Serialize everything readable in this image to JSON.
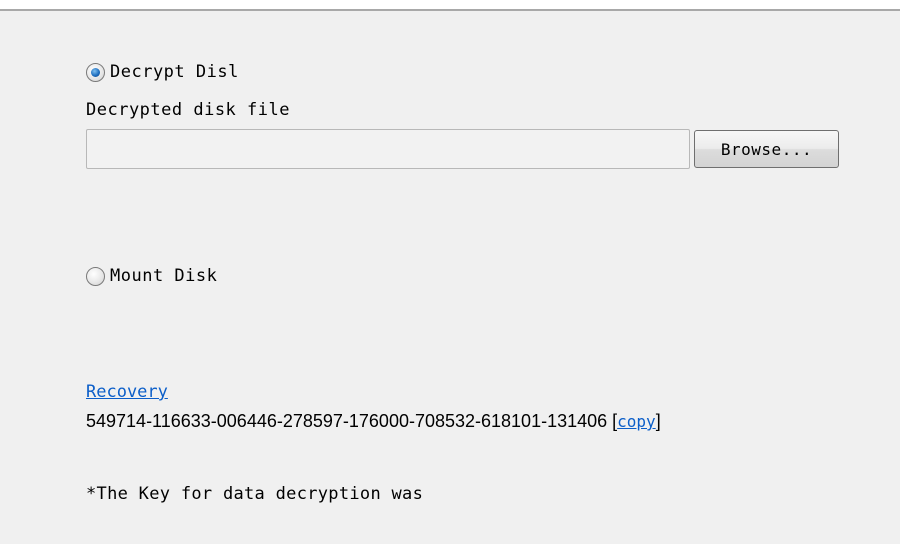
{
  "options": {
    "decrypt": {
      "label": "Decrypt Disl",
      "selected": true
    },
    "mount": {
      "label": "Mount Disk",
      "selected": false
    }
  },
  "decrypt_section": {
    "field_label": "Decrypted disk file",
    "input_value": "",
    "browse_label": "Browse..."
  },
  "recovery": {
    "link_label": "Recovery",
    "key": "549714-116633-006446-278597-176000-708532-618101-131406",
    "copy_open": " [",
    "copy_label": "copy",
    "copy_close": "]"
  },
  "note": "*The Key for data decryption was",
  "colors": {
    "link": "#0b5ec9",
    "background": "#f0f0f0",
    "radio_selected": "#1f6fc0"
  }
}
